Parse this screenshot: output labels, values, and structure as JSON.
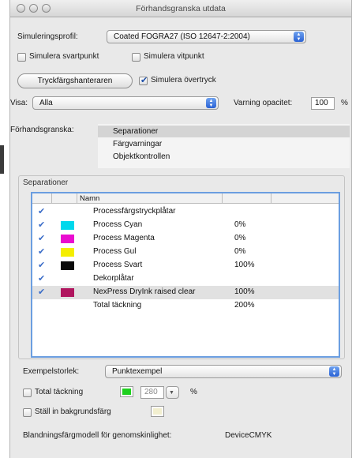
{
  "window": {
    "title": "Förhandsgranska utdata"
  },
  "profile": {
    "label": "Simuleringsprofil:",
    "value": "Coated FOGRA27 (ISO 12647-2:2004)"
  },
  "simulate": {
    "black_label": "Simulera svartpunkt",
    "white_label": "Simulera vitpunkt",
    "overprint_label": "Simulera övertryck"
  },
  "ink_manager": {
    "label": "Tryckfärgshanteraren"
  },
  "show": {
    "label": "Visa:",
    "value": "Alla",
    "warning_label": "Varning opacitet:",
    "warning_value": "100",
    "warning_unit": "%"
  },
  "preview": {
    "label": "Förhandsgranska:",
    "items": [
      "Separationer",
      "Färgvarningar",
      "Objektkontrollen"
    ],
    "selected": 0
  },
  "separations": {
    "title": "Separationer",
    "column_name": "Namn",
    "rows": [
      {
        "checked": true,
        "color": "",
        "name": "Processfärgstryckplåtar",
        "value": ""
      },
      {
        "checked": true,
        "color": "#00d8ec",
        "name": "Process Cyan",
        "value": "0%"
      },
      {
        "checked": true,
        "color": "#ea0cd0",
        "name": "Process Magenta",
        "value": "0%"
      },
      {
        "checked": true,
        "color": "#f4ee00",
        "name": "Process Gul",
        "value": "0%"
      },
      {
        "checked": true,
        "color": "#0a0a0a",
        "name": "Process Svart",
        "value": "100%"
      },
      {
        "checked": true,
        "color": "",
        "name": "Dekorplåtar",
        "value": ""
      },
      {
        "checked": true,
        "color": "#b0165f",
        "name": "NexPress DryInk raised clear",
        "value": "100%"
      },
      {
        "checked": false,
        "color": "",
        "name": "Total täckning",
        "value": "200%"
      }
    ]
  },
  "sample": {
    "label": "Exempelstorlek:",
    "value": "Punktexempel"
  },
  "total_coverage": {
    "label": "Total täckning",
    "value": "280",
    "unit": "%",
    "color": "#1ed01e"
  },
  "background": {
    "label": "Ställ in bakgrundsfärg",
    "color": "#f2efcf"
  },
  "blend": {
    "label": "Blandningsfärgmodell för genomskinlighet:",
    "value": "DeviceCMYK"
  }
}
